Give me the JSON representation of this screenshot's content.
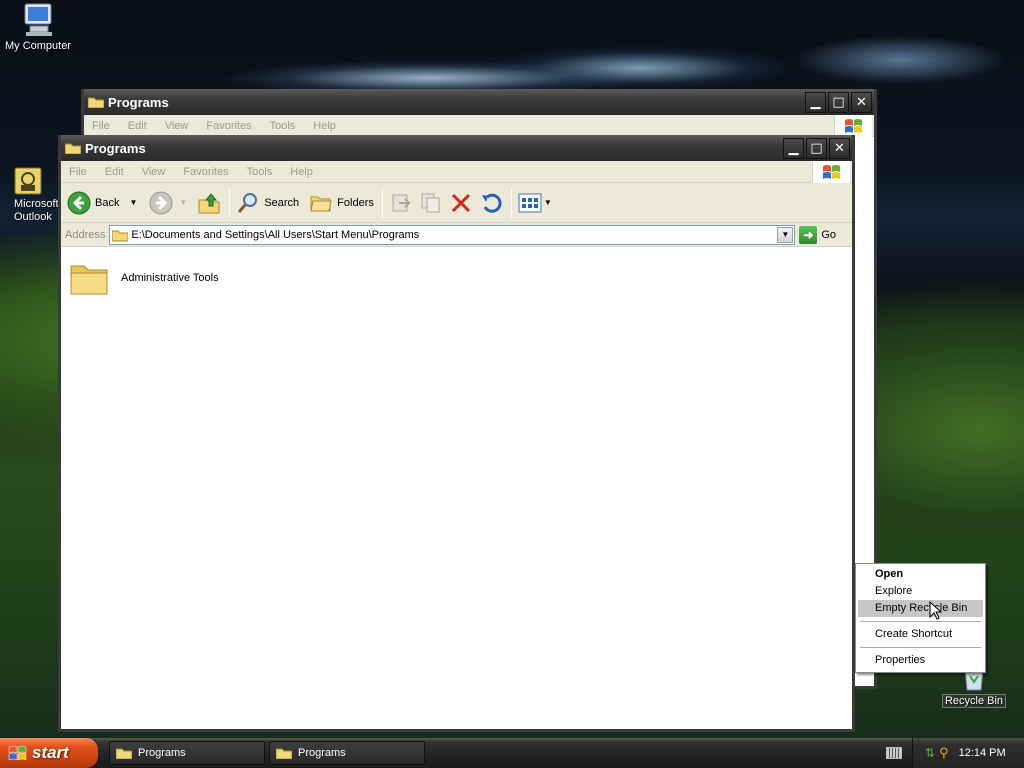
{
  "desktop": {
    "icons": [
      {
        "label": "My Computer",
        "icon": "my-computer-icon"
      },
      {
        "label": "Microsoft Outlook",
        "icon": "outlook-icon"
      },
      {
        "label": "Recycle Bin",
        "icon": "recycle-bin-icon"
      }
    ]
  },
  "back_window": {
    "title": "Programs",
    "menu": [
      "File",
      "Edit",
      "View",
      "Favorites",
      "Tools",
      "Help"
    ]
  },
  "window": {
    "title": "Programs",
    "menu": [
      "File",
      "Edit",
      "View",
      "Favorites",
      "Tools",
      "Help"
    ],
    "toolbar": {
      "back_label": "Back",
      "search_label": "Search",
      "folders_label": "Folders"
    },
    "address": {
      "label": "Address",
      "value": "E:\\Documents and Settings\\All Users\\Start Menu\\Programs",
      "go_label": "Go"
    },
    "items": [
      {
        "name": "Administrative Tools",
        "icon": "folder-icon"
      }
    ]
  },
  "context_menu": {
    "items": [
      {
        "label": "Open",
        "bold": true
      },
      {
        "label": "Explore"
      },
      {
        "label": "Empty Recycle Bin",
        "highlighted": true
      },
      {
        "label": "Create Shortcut"
      },
      {
        "label": "Properties"
      }
    ]
  },
  "taskbar": {
    "start_label": "start",
    "tasks": [
      {
        "label": "Programs"
      },
      {
        "label": "Programs"
      }
    ],
    "clock": "12:14 PM"
  },
  "colors": {
    "start_button": "#e24f1a",
    "title_bar": "#3c3c3c",
    "menu_background": "#ece9d8",
    "highlight": "#c6c6c6"
  }
}
